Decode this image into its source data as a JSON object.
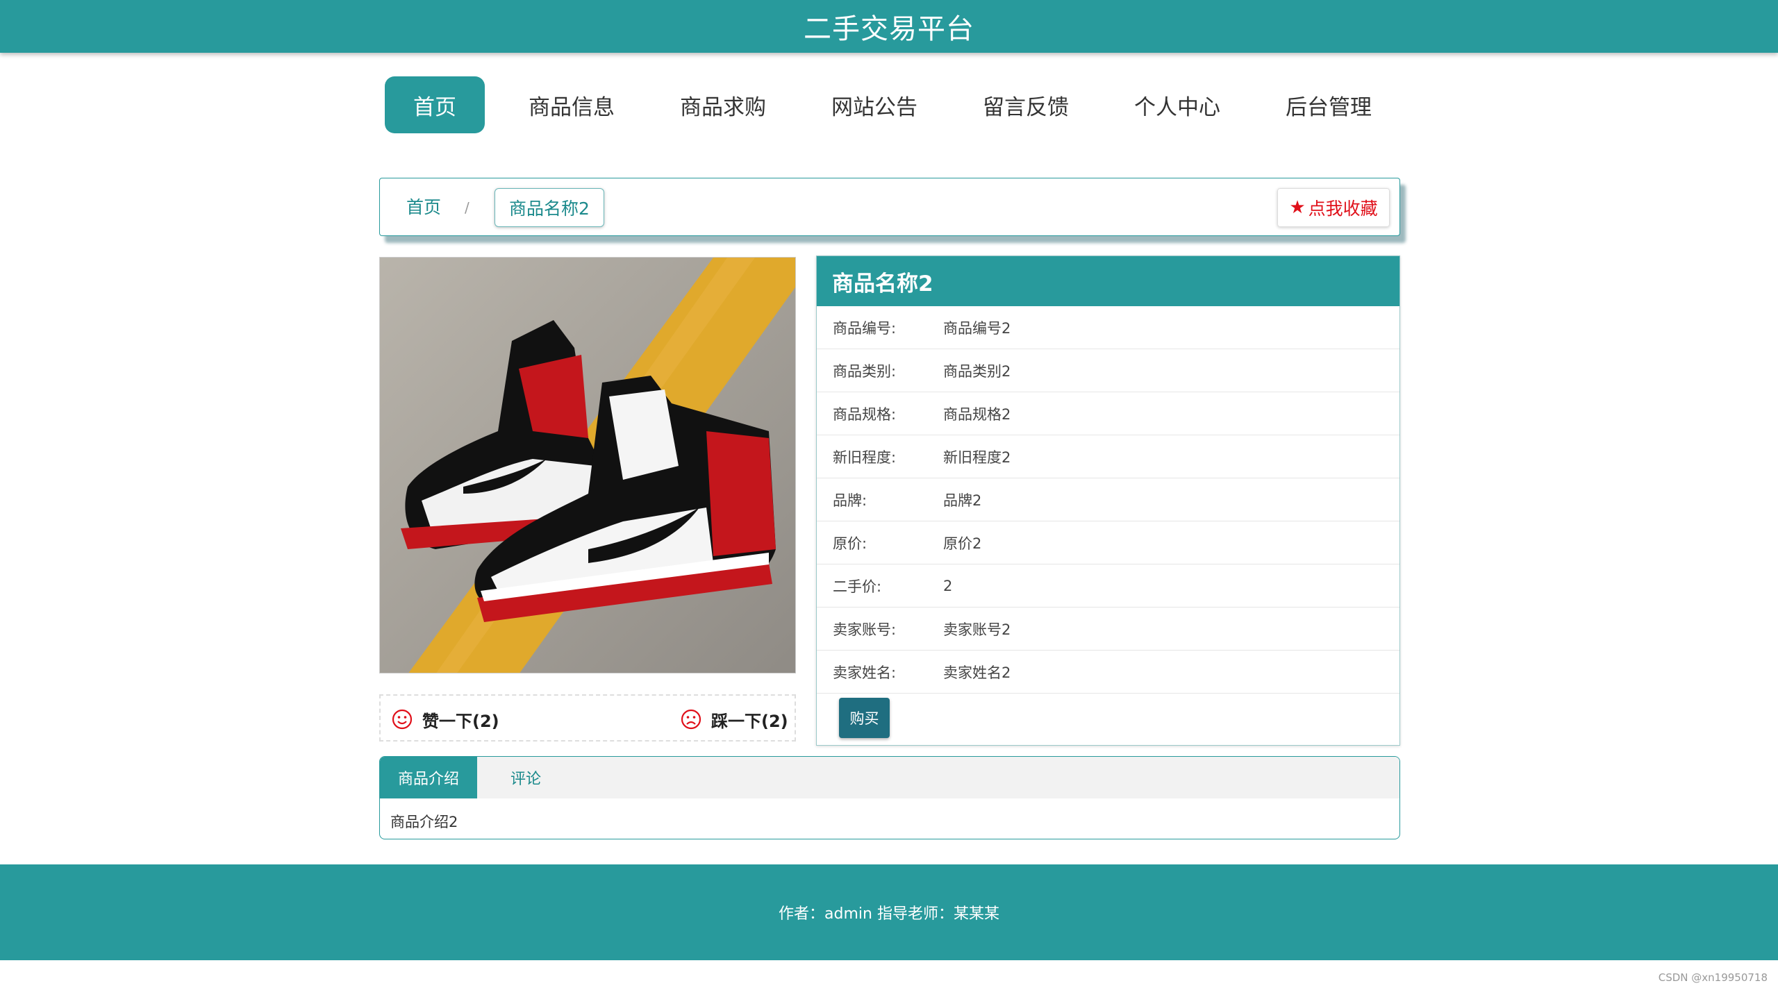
{
  "site": {
    "title": "二手交易平台"
  },
  "nav": {
    "items": [
      {
        "label": "首页"
      },
      {
        "label": "商品信息"
      },
      {
        "label": "商品求购"
      },
      {
        "label": "网站公告"
      },
      {
        "label": "留言反馈"
      },
      {
        "label": "个人中心"
      },
      {
        "label": "后台管理"
      }
    ]
  },
  "breadcrumb": {
    "home": "首页",
    "separator": "/",
    "current": "商品名称2"
  },
  "favorite": {
    "label": "点我收藏",
    "icon": "star-icon"
  },
  "votes": {
    "like": {
      "label": "赞一下(2)",
      "icon": "smile-face-icon"
    },
    "dislike": {
      "label": "踩一下(2)",
      "icon": "sad-face-icon"
    }
  },
  "product": {
    "name": "商品名称2",
    "fields": [
      {
        "label": "商品编号:",
        "value": "商品编号2"
      },
      {
        "label": "商品类别:",
        "value": "商品类别2"
      },
      {
        "label": "商品规格:",
        "value": "商品规格2"
      },
      {
        "label": "新旧程度:",
        "value": "新旧程度2"
      },
      {
        "label": "品牌:",
        "value": "品牌2"
      },
      {
        "label": "原价:",
        "value": "原价2"
      },
      {
        "label": "二手价:",
        "value": "2"
      },
      {
        "label": "卖家账号:",
        "value": "卖家账号2"
      },
      {
        "label": "卖家姓名:",
        "value": "卖家姓名2"
      }
    ],
    "buy_label": "购买"
  },
  "tabs": {
    "items": [
      {
        "label": "商品介绍"
      },
      {
        "label": "评论"
      }
    ],
    "content": "商品介绍2"
  },
  "footer": {
    "text": "作者：admin 指导老师：某某某"
  },
  "watermark": "CSDN @xn19950718",
  "colors": {
    "primary": "#289a9c",
    "accent_red": "#e0101a",
    "buy_button": "#1f6e80"
  }
}
